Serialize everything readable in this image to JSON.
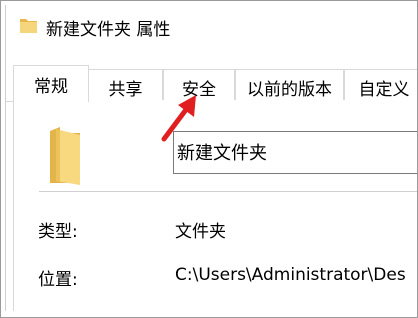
{
  "window": {
    "title": "新建文件夹 属性"
  },
  "tabs": [
    {
      "label": "常规",
      "active": true
    },
    {
      "label": "共享",
      "active": false
    },
    {
      "label": "安全",
      "active": false
    },
    {
      "label": "以前的版本",
      "active": false
    },
    {
      "label": "自定义",
      "active": false
    }
  ],
  "general": {
    "folder_name": "新建文件夹",
    "type_label": "类型:",
    "type_value": "文件夹",
    "location_label": "位置:",
    "location_value": "C:\\Users\\Administrator\\Des"
  },
  "icons": {
    "title_icon": "folder-icon",
    "large_icon": "folder-icon",
    "annotation": "red-arrow-icon"
  },
  "colors": {
    "folder": "#f3d277",
    "arrow": "#e02020"
  }
}
